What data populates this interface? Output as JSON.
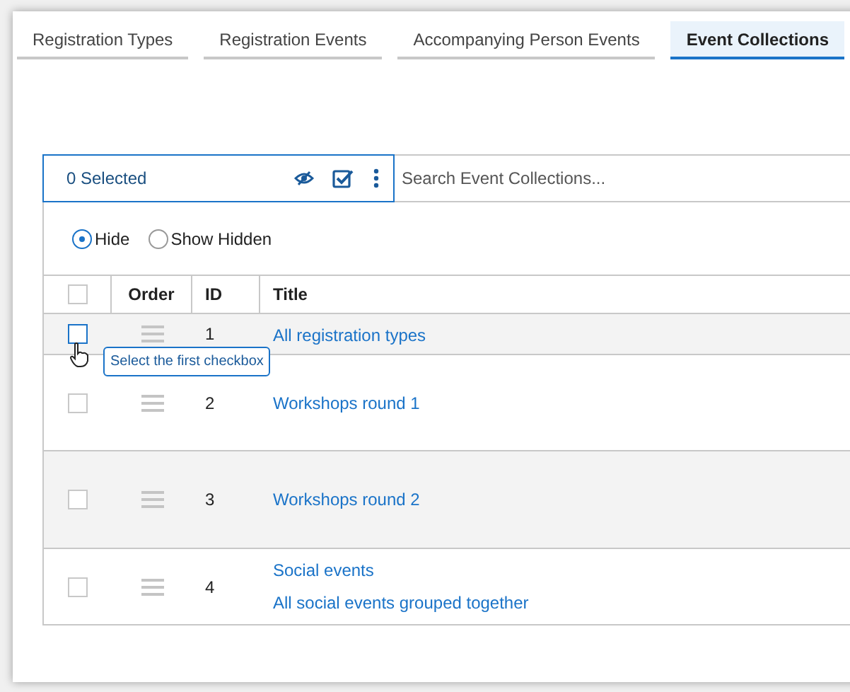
{
  "tabs": [
    {
      "label": "Registration Types",
      "selected": false
    },
    {
      "label": "Registration Events",
      "selected": false
    },
    {
      "label": "Accompanying Person Events",
      "selected": false
    },
    {
      "label": "Event Collections",
      "selected": true
    }
  ],
  "toolbar": {
    "selected_count": "0 Selected",
    "search": {
      "placeholder": "Search Event Collections..."
    }
  },
  "visibility": [
    {
      "label": "Hide",
      "selected": true
    },
    {
      "label": "Show Hidden",
      "selected": false
    }
  ],
  "table": {
    "select_all": {
      "checked": false
    },
    "columns": [
      "Order",
      "ID",
      "Title"
    ],
    "rows": [
      {
        "id": "1",
        "title": "All registration types",
        "checked": false,
        "hovered": true,
        "tooltip": "Select the first checkbox"
      },
      {
        "id": "2",
        "title": "Workshops round 1",
        "checked": false,
        "hovered": false
      },
      {
        "id": "3",
        "title": "Workshops round 2",
        "checked": false,
        "hovered": false
      },
      {
        "id": "4",
        "title": "Social events",
        "description": "All social events grouped together",
        "checked": false,
        "hovered": false
      }
    ]
  }
}
